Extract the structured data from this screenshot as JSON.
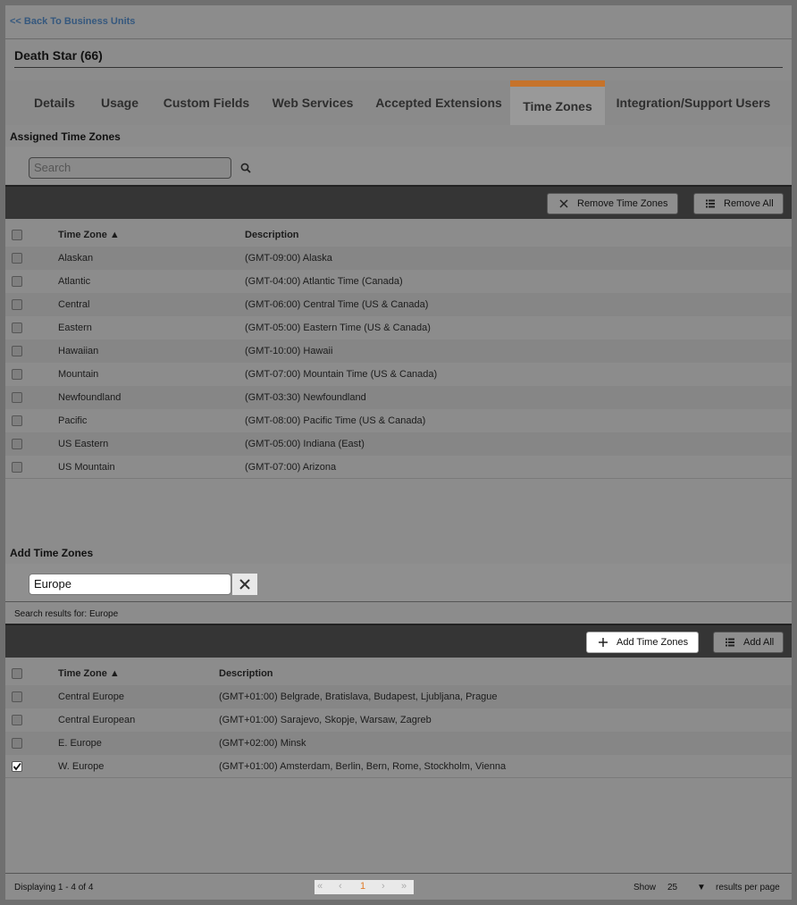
{
  "header": {
    "back_link": "<< Back To Business Units",
    "unit_title": "Death Star (66)"
  },
  "tabs": [
    {
      "label": "Details"
    },
    {
      "label": "Usage"
    },
    {
      "label": "Custom Fields"
    },
    {
      "label": "Web Services"
    },
    {
      "label": "Accepted Extensions"
    },
    {
      "label": "Time Zones",
      "active": true
    },
    {
      "label": "Integration/Support Users"
    }
  ],
  "colors": {
    "active_tab_accent": "#c6732b",
    "toolbar_bg": "#353535",
    "pager_current": "#e07b2a"
  },
  "assigned": {
    "section_label": "Assigned Time Zones",
    "search_placeholder": "Search",
    "remove_button": "Remove Time Zones",
    "remove_all_button": "Remove All",
    "col_timezone": "Time Zone",
    "col_description": "Description",
    "rows": [
      {
        "zone": "Alaskan",
        "desc": "(GMT-09:00) Alaska"
      },
      {
        "zone": "Atlantic",
        "desc": "(GMT-04:00) Atlantic Time (Canada)"
      },
      {
        "zone": "Central",
        "desc": "(GMT-06:00) Central Time (US & Canada)"
      },
      {
        "zone": "Eastern",
        "desc": "(GMT-05:00) Eastern Time (US & Canada)"
      },
      {
        "zone": "Hawaiian",
        "desc": "(GMT-10:00) Hawaii"
      },
      {
        "zone": "Mountain",
        "desc": "(GMT-07:00) Mountain Time (US & Canada)"
      },
      {
        "zone": "Newfoundland",
        "desc": "(GMT-03:30) Newfoundland"
      },
      {
        "zone": "Pacific",
        "desc": "(GMT-08:00) Pacific Time (US & Canada)"
      },
      {
        "zone": "US Eastern",
        "desc": "(GMT-05:00) Indiana (East)"
      },
      {
        "zone": "US Mountain",
        "desc": "(GMT-07:00) Arizona"
      }
    ]
  },
  "add": {
    "section_label": "Add Time Zones",
    "search_value": "Europe",
    "results_for_label": "Search results for:",
    "results_for_value": "Europe",
    "add_button": "Add Time Zones",
    "add_all_button": "Add All",
    "col_timezone": "Time Zone",
    "col_description": "Description",
    "rows": [
      {
        "zone": "Central Europe",
        "desc": "(GMT+01:00) Belgrade, Bratislava, Budapest, Ljubljana, Prague",
        "checked": false
      },
      {
        "zone": "Central European",
        "desc": "(GMT+01:00) Sarajevo, Skopje, Warsaw, Zagreb",
        "checked": false
      },
      {
        "zone": "E. Europe",
        "desc": "(GMT+02:00) Minsk",
        "checked": false
      },
      {
        "zone": "W. Europe",
        "desc": "(GMT+01:00) Amsterdam, Berlin, Bern, Rome, Stockholm, Vienna",
        "checked": true
      }
    ]
  },
  "footer": {
    "displaying": "Displaying 1 - 4 of 4",
    "current_page": "1",
    "show_label": "Show",
    "per_page": "25",
    "per_page_suffix": "results per page"
  }
}
